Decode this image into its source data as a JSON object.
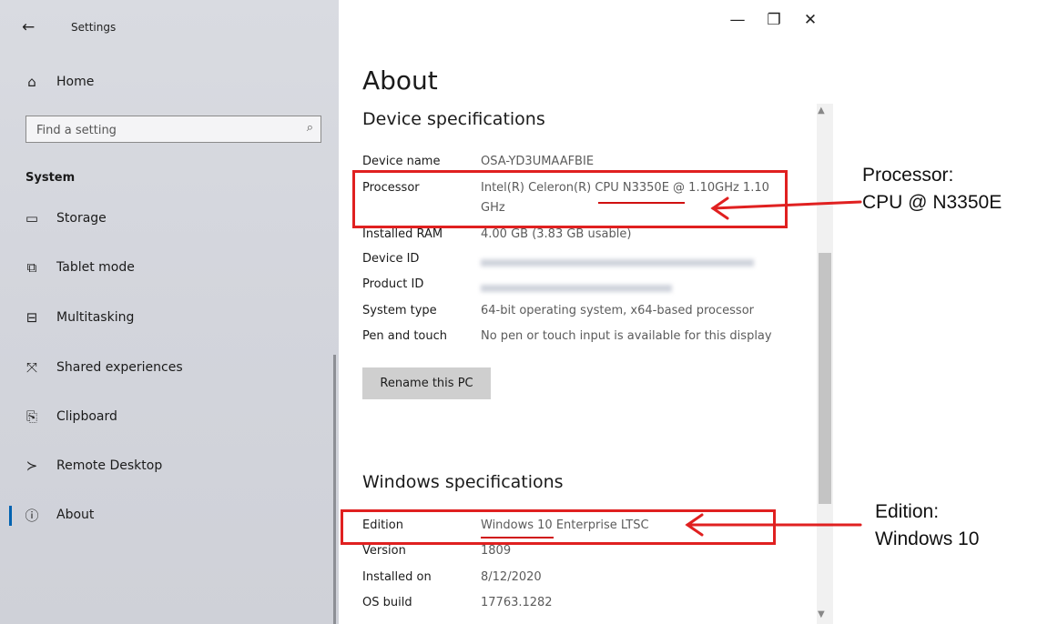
{
  "window": {
    "title": "Settings",
    "back_icon": "←",
    "minimize": "—",
    "restore": "❐",
    "close": "✕"
  },
  "sidebar": {
    "home_label": "Home",
    "search_placeholder": "Find a setting",
    "section": "System",
    "items": [
      {
        "label": "Storage",
        "icon": "▭"
      },
      {
        "label": "Tablet mode",
        "icon": "⧉"
      },
      {
        "label": "Multitasking",
        "icon": "⊟"
      },
      {
        "label": "Shared experiences",
        "icon": "⤧"
      },
      {
        "label": "Clipboard",
        "icon": "📋"
      },
      {
        "label": "Remote Desktop",
        "icon": "≻"
      },
      {
        "label": "About",
        "icon": "ⓘ"
      }
    ],
    "selected": "About"
  },
  "main": {
    "title": "About",
    "device_specs": {
      "heading": "Device specifications",
      "rows": [
        {
          "key": "Device name",
          "value": "OSA-YD3UMAAFBIE"
        },
        {
          "key": "Processor",
          "value_line1": "Intel(R) Celeron(R) CPU N3350E @ 1.10GHz   1.10",
          "value_line2": "GHz"
        },
        {
          "key": "Installed RAM",
          "value": "4.00 GB (3.83 GB usable)"
        },
        {
          "key": "Device ID",
          "value": ""
        },
        {
          "key": "Product ID",
          "value": ""
        },
        {
          "key": "System type",
          "value": "64-bit operating system, x64-based processor"
        },
        {
          "key": "Pen and touch",
          "value": "No pen or touch input is available for this display"
        }
      ],
      "rename_button": "Rename this PC"
    },
    "windows_specs": {
      "heading": "Windows specifications",
      "rows": [
        {
          "key": "Edition",
          "value": "Windows 10 Enterprise LTSC"
        },
        {
          "key": "Version",
          "value": "1809"
        },
        {
          "key": "Installed on",
          "value": "8/12/2020"
        },
        {
          "key": "OS build",
          "value": "17763.1282"
        }
      ]
    }
  },
  "annotations": {
    "processor_line1": "Processor:",
    "processor_line2": "CPU @ N3350E",
    "edition_line1": "Edition:",
    "edition_line2": "Windows 10",
    "color": "#e02020"
  }
}
